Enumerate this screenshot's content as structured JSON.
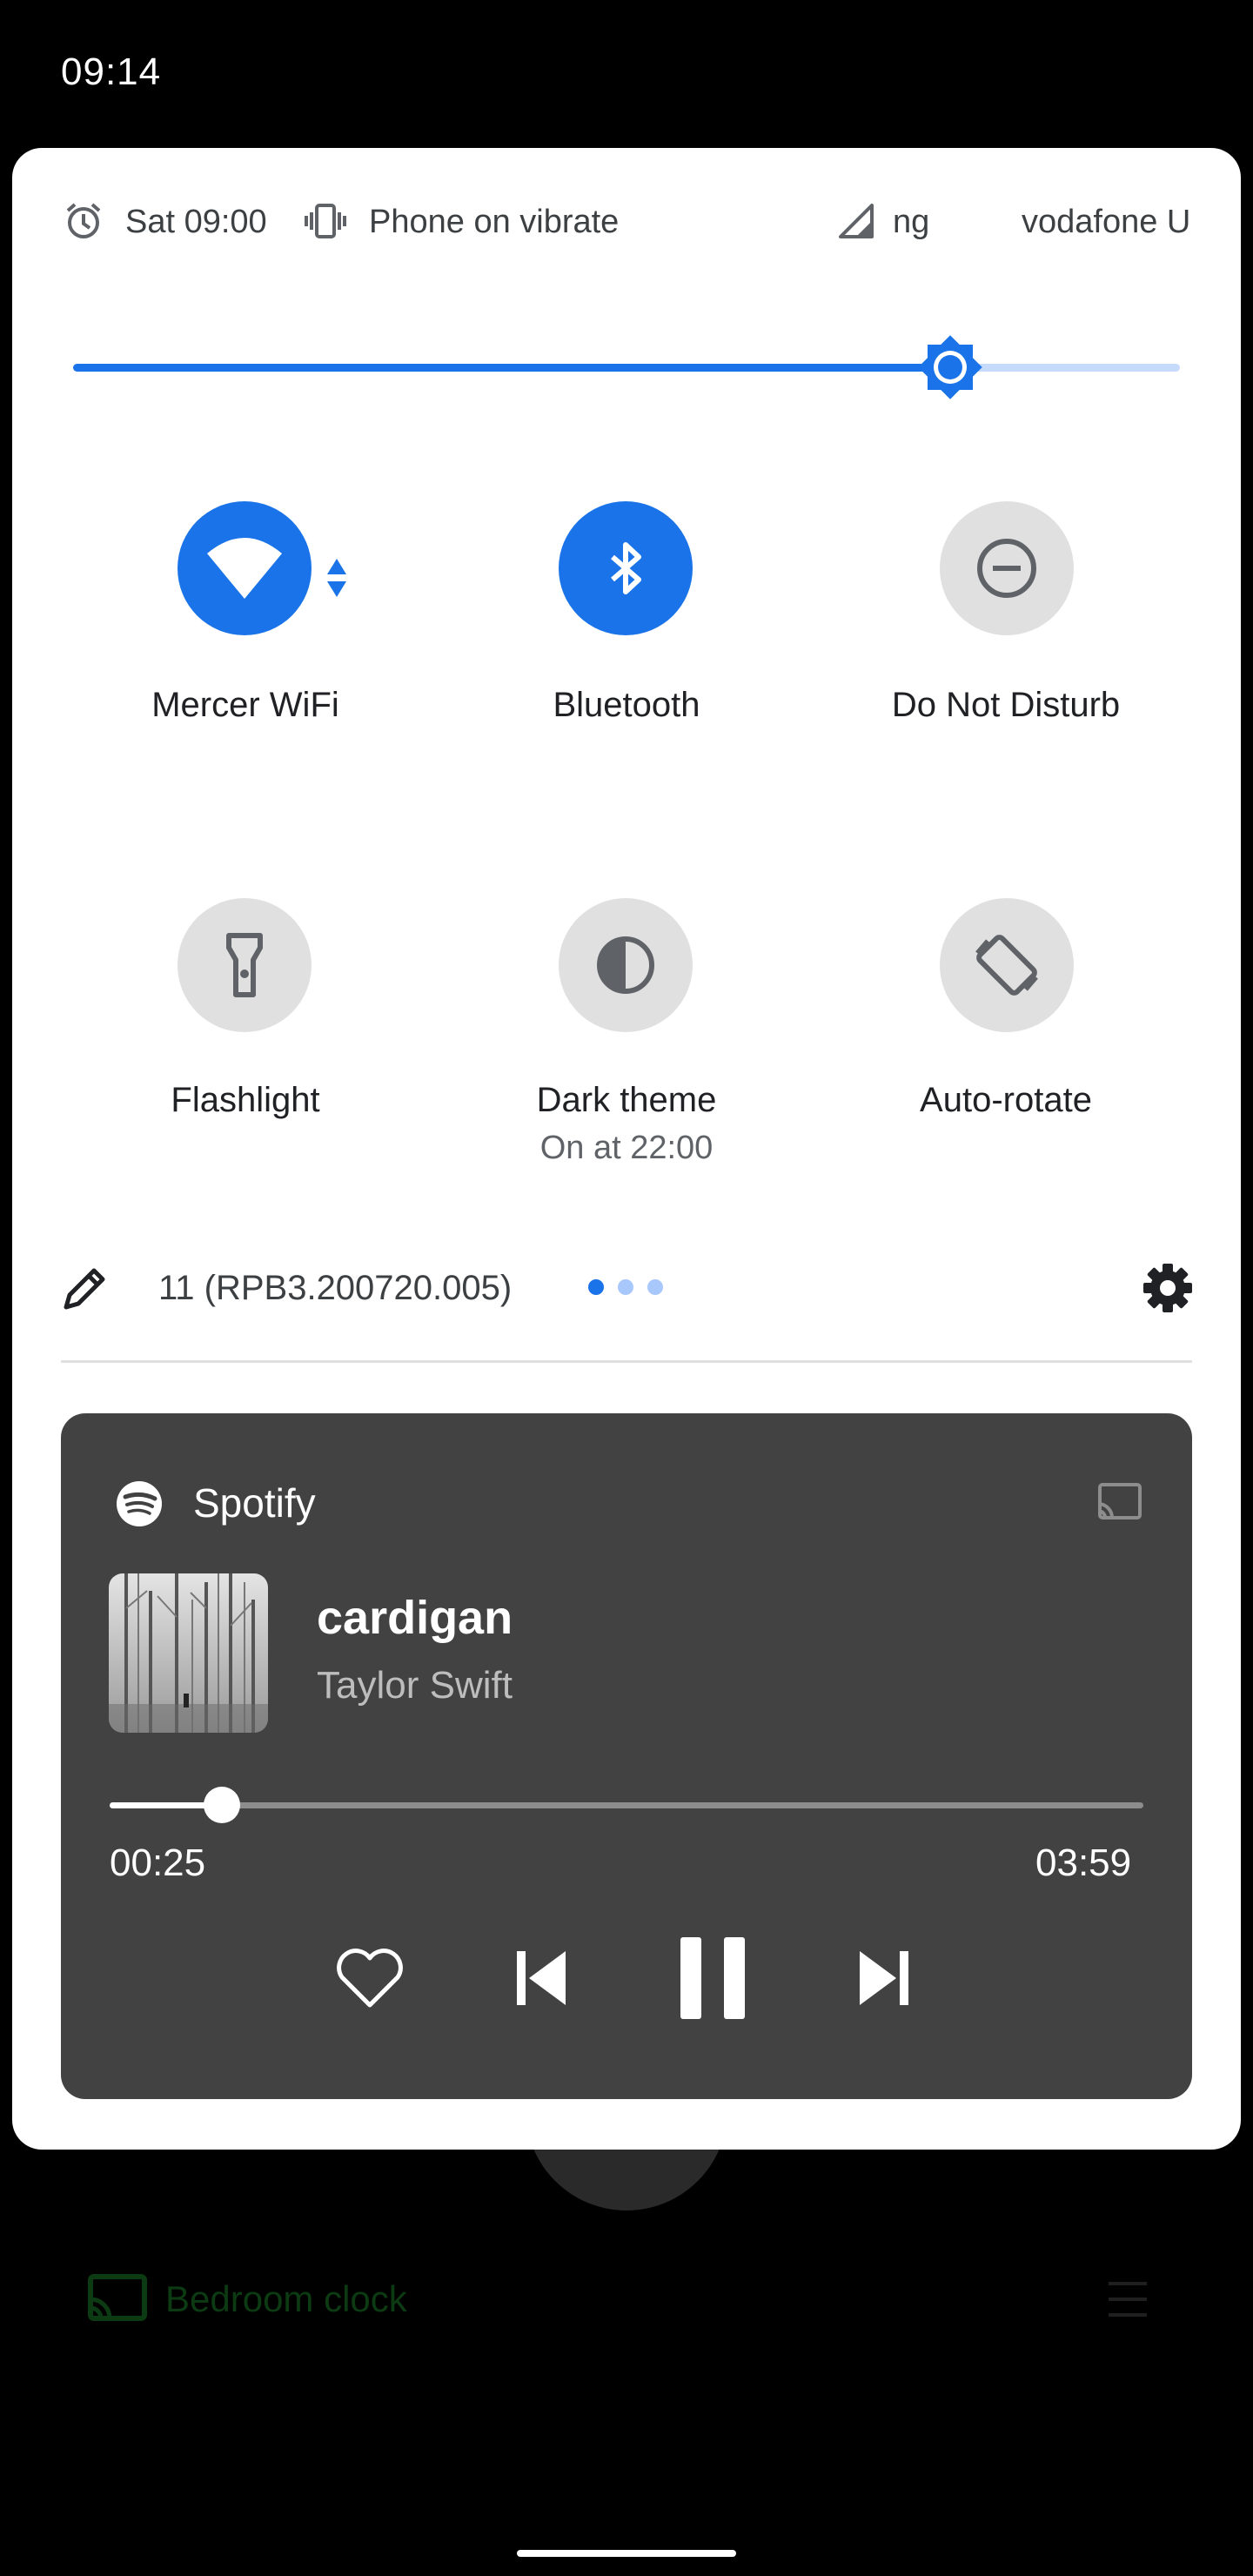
{
  "status_bar": {
    "time": "09:14"
  },
  "header": {
    "alarm": "Sat 09:00",
    "ringer": "Phone on vibrate",
    "network_partial": "ng",
    "carrier": "vodafone U"
  },
  "brightness": {
    "level": 0.8
  },
  "tiles": [
    {
      "label": "Mercer WiFi",
      "state": "on",
      "icon": "wifi-icon"
    },
    {
      "label": "Bluetooth",
      "state": "on",
      "icon": "bluetooth-icon"
    },
    {
      "label": "Do Not Disturb",
      "state": "off",
      "icon": "do-not-disturb-icon"
    },
    {
      "label": "Flashlight",
      "state": "off",
      "icon": "flashlight-icon"
    },
    {
      "label": "Dark theme",
      "sublabel": "On at 22:00",
      "state": "off",
      "icon": "dark-theme-icon"
    },
    {
      "label": "Auto-rotate",
      "state": "off",
      "icon": "auto-rotate-icon"
    }
  ],
  "footer": {
    "build": "11 (RPB3.200720.005)",
    "page_count": 3,
    "current_page": 1
  },
  "media": {
    "app": "Spotify",
    "title": "cardigan",
    "artist": "Taylor Swift",
    "elapsed": "00:25",
    "duration": "03:59",
    "progress": 0.105
  },
  "background_app": {
    "label": "Bedroom clock"
  },
  "colors": {
    "accent": "#1a73e8",
    "accent_light": "#c6dafc",
    "tile_off": "#e0e0e0",
    "media_card": "#424242",
    "spotify_green": "#1db954"
  }
}
